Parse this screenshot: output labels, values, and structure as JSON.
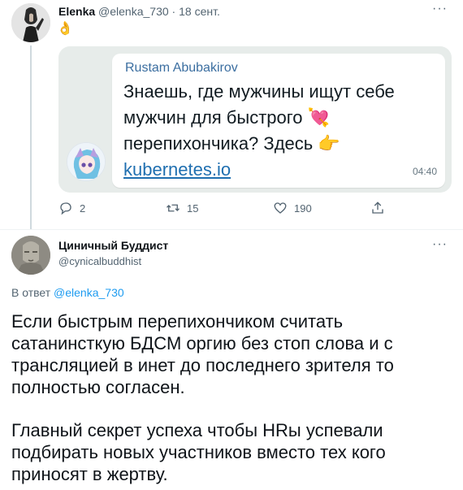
{
  "tweet1": {
    "author_name": "Elenka",
    "author_handle": "@elenka_730",
    "separator": "·",
    "date": "18 сент.",
    "more_label": "···",
    "emoji": "👌",
    "embedded_screenshot": {
      "sender_name": "Rustam Abubakirov",
      "message_lines": [
        "Знаешь, где мужчины ищут себе",
        "мужчин для быстрого",
        "перепихончика? Здесь"
      ],
      "heart_emoji": "💘",
      "pointing_emoji": "👉",
      "link_text": "kubernetes.io",
      "time": "04:40"
    },
    "actions": {
      "reply_count": "2",
      "retweet_count": "15",
      "like_count": "190"
    }
  },
  "tweet2": {
    "author_name": "Циничный Буддист",
    "author_handle": "@cynicalbuddhist",
    "more_label": "···",
    "reply_prefix": "В ответ",
    "reply_mention": "@elenka_730",
    "paragraph1_lines": [
      "Если быстрым перепихончиком считать",
      "сатанинсткую БДСМ оргию без стоп слова и с",
      "трансляцией в инет до последнего зрителя то",
      "полностью согласен."
    ],
    "paragraph2_lines": [
      "Главный секрет успеха чтобы HRы успевали",
      "подбирать новых участников вместо тех кого",
      "приносят в жертву."
    ]
  },
  "colors": {
    "text_primary": "#0f1419",
    "text_secondary": "#536471",
    "mention_blue": "#1d9bf0",
    "whatsapp_sender": "#3b6ea0",
    "whatsapp_link": "#1f6fb0",
    "whatsapp_background": "#e7ecea"
  },
  "icons": {
    "reply": "reply-icon",
    "retweet": "retweet-icon",
    "like": "heart-icon",
    "share": "share-icon",
    "more": "more-icon"
  }
}
